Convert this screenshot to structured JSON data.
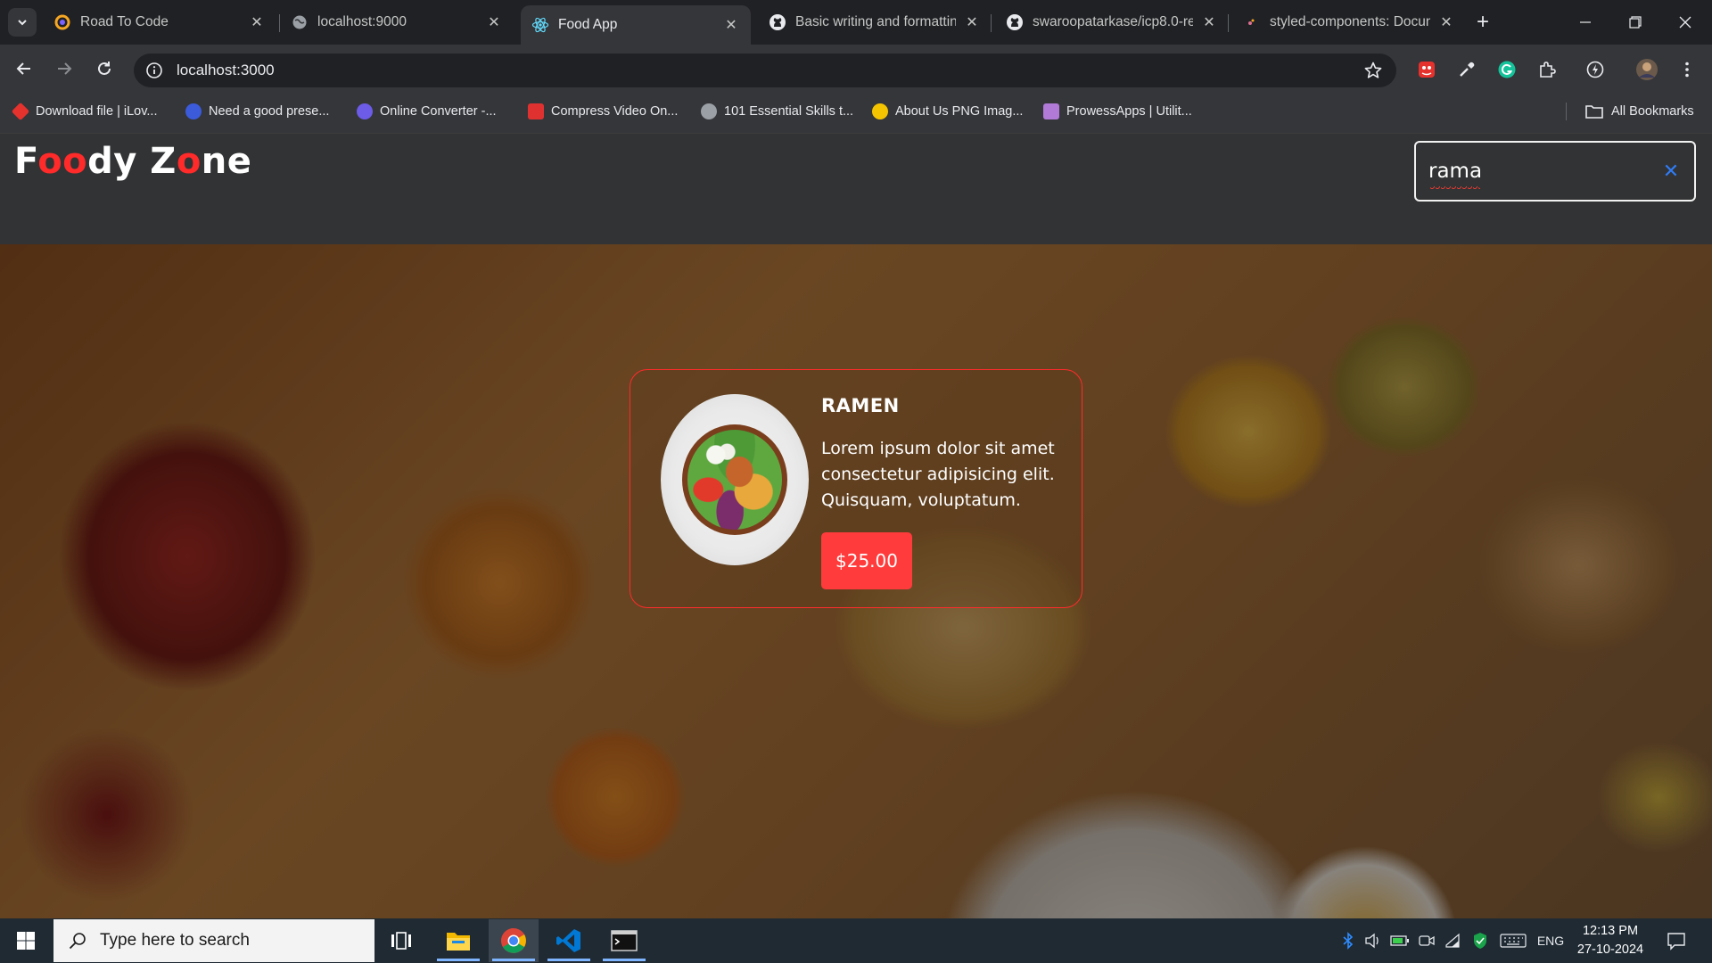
{
  "browser": {
    "tabs": [
      {
        "title": "Road To Code",
        "icon": "road-to-code-icon",
        "active": false
      },
      {
        "title": "localhost:9000",
        "icon": "globe-icon",
        "active": false
      },
      {
        "title": "Food App",
        "icon": "react-icon",
        "active": true
      },
      {
        "title": "Basic writing and formattin",
        "icon": "github-icon",
        "active": false
      },
      {
        "title": "swaroopatarkase/icp8.0-re",
        "icon": "github-icon",
        "active": false
      },
      {
        "title": "styled-components: Docun",
        "icon": "styled-components-icon",
        "active": false
      }
    ],
    "url": "localhost:3000",
    "bookmarks": [
      {
        "label": "Download file | iLov...",
        "color": "#e5322d"
      },
      {
        "label": "Need a good prese...",
        "color": "#3b5bdb"
      },
      {
        "label": "Online Converter -...",
        "color": "#6c5ce7"
      },
      {
        "label": "Compress Video On...",
        "color": "#e03131"
      },
      {
        "label": "101 Essential Skills t...",
        "color": "#9aa0a6"
      },
      {
        "label": "About Us PNG Imag...",
        "color": "#f5c400"
      },
      {
        "label": "ProwessApps | Utilit...",
        "color": "#b07ad6"
      }
    ],
    "all_bookmarks": "All Bookmarks"
  },
  "app": {
    "logo": {
      "p1": "F",
      "p2": "oo",
      "p3": "dy Z",
      "p4": "o",
      "p5": "ne"
    },
    "search": {
      "value": "rama"
    },
    "card": {
      "name": "RAMEN",
      "description": "Lorem ipsum dolor sit amet consectetur adipisicing elit. Quisquam, voluptatum.",
      "price": "$25.00"
    },
    "colors": {
      "accent": "#ff3b3b",
      "card_border": "#ff2b2b",
      "clear_icon": "#2f7cf6"
    }
  },
  "taskbar": {
    "search_placeholder": "Type here to search",
    "language": "ENG",
    "time": "12:13 PM",
    "date": "27-10-2024"
  }
}
